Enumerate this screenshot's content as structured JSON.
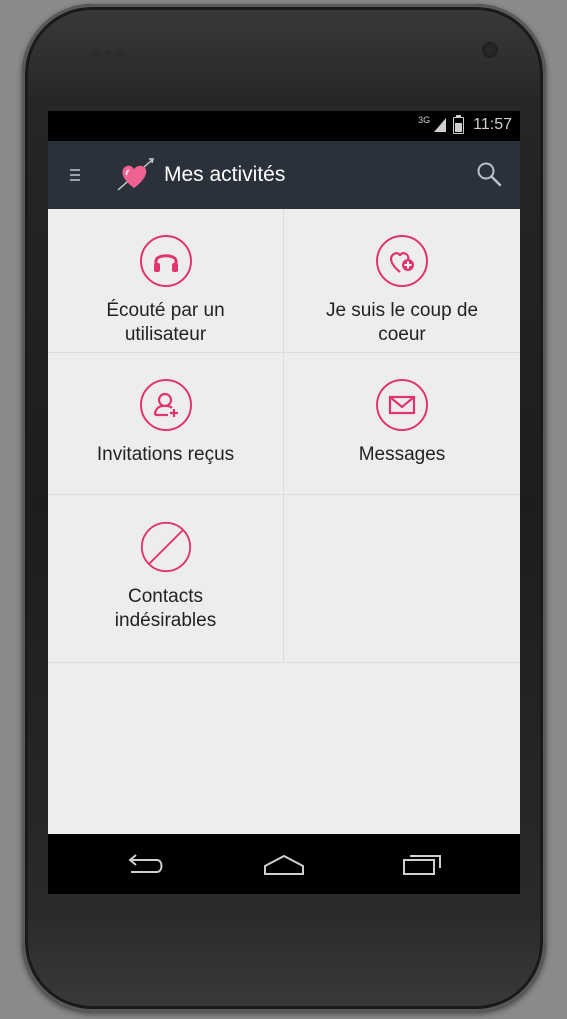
{
  "status_bar": {
    "network": "3G",
    "time": "11:57"
  },
  "action_bar": {
    "title": "Mes activités"
  },
  "tiles": [
    {
      "label_line1": "Écouté par un",
      "label_line2": "utilisateur",
      "icon": "headphones-icon"
    },
    {
      "label_line1": "Je suis le coup de",
      "label_line2": "coeur",
      "icon": "heart-plus-icon"
    },
    {
      "label_line1": "Invitations reçus",
      "label_line2": "",
      "icon": "user-add-icon"
    },
    {
      "label_line1": "Messages",
      "label_line2": "",
      "icon": "envelope-icon"
    },
    {
      "label_line1": "Contacts",
      "label_line2": "indésirables",
      "icon": "block-icon"
    }
  ],
  "nav": {
    "back": "back-icon",
    "home": "home-icon",
    "recents": "recents-icon"
  },
  "colors": {
    "accent": "#e0346f",
    "action_bar": "#2a313b",
    "screen_bg": "#ededed"
  }
}
